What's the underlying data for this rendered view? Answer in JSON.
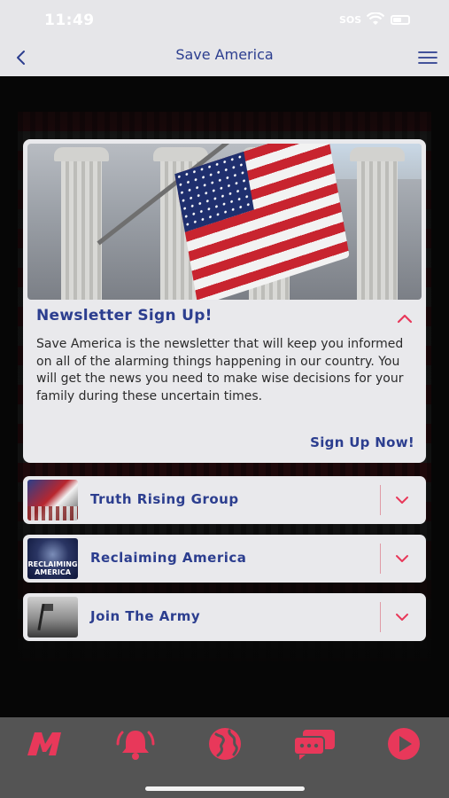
{
  "status_bar": {
    "time": "11:49",
    "signal": "SOS"
  },
  "nav": {
    "title": "Save America",
    "back_icon": "chevron-left-icon",
    "menu_icon": "hamburger-menu-icon"
  },
  "featured": {
    "image": "capitol-columns-with-american-flag",
    "title": "Newsletter Sign Up!",
    "body": "Save America is the newsletter that will keep you informed on all of the alarming things happening in our country. You will get the news you need to make wise decisions for your family during these uncertain times.",
    "cta": "Sign Up Now!",
    "expanded": true
  },
  "items": [
    {
      "label": "Truth Rising Group",
      "thumb": "truth-rising-thumbnail",
      "expanded": false
    },
    {
      "label": "Reclaiming America",
      "thumb": "reclaiming-america-thumbnail",
      "thumb_text": "RECLAIMING AMERICA",
      "expanded": false
    },
    {
      "label": "Join The Army",
      "thumb": "join-the-army-thumbnail",
      "expanded": false
    }
  ],
  "tabs": [
    {
      "icon": "m-logo-icon"
    },
    {
      "icon": "bell-icon"
    },
    {
      "icon": "globe-icon"
    },
    {
      "icon": "chat-icon"
    },
    {
      "icon": "play-icon"
    }
  ],
  "colors": {
    "accent": "#e8385a",
    "title_blue": "#2c3e8f",
    "card_bg": "#e9e9ec",
    "tab_bar": "#545454"
  }
}
